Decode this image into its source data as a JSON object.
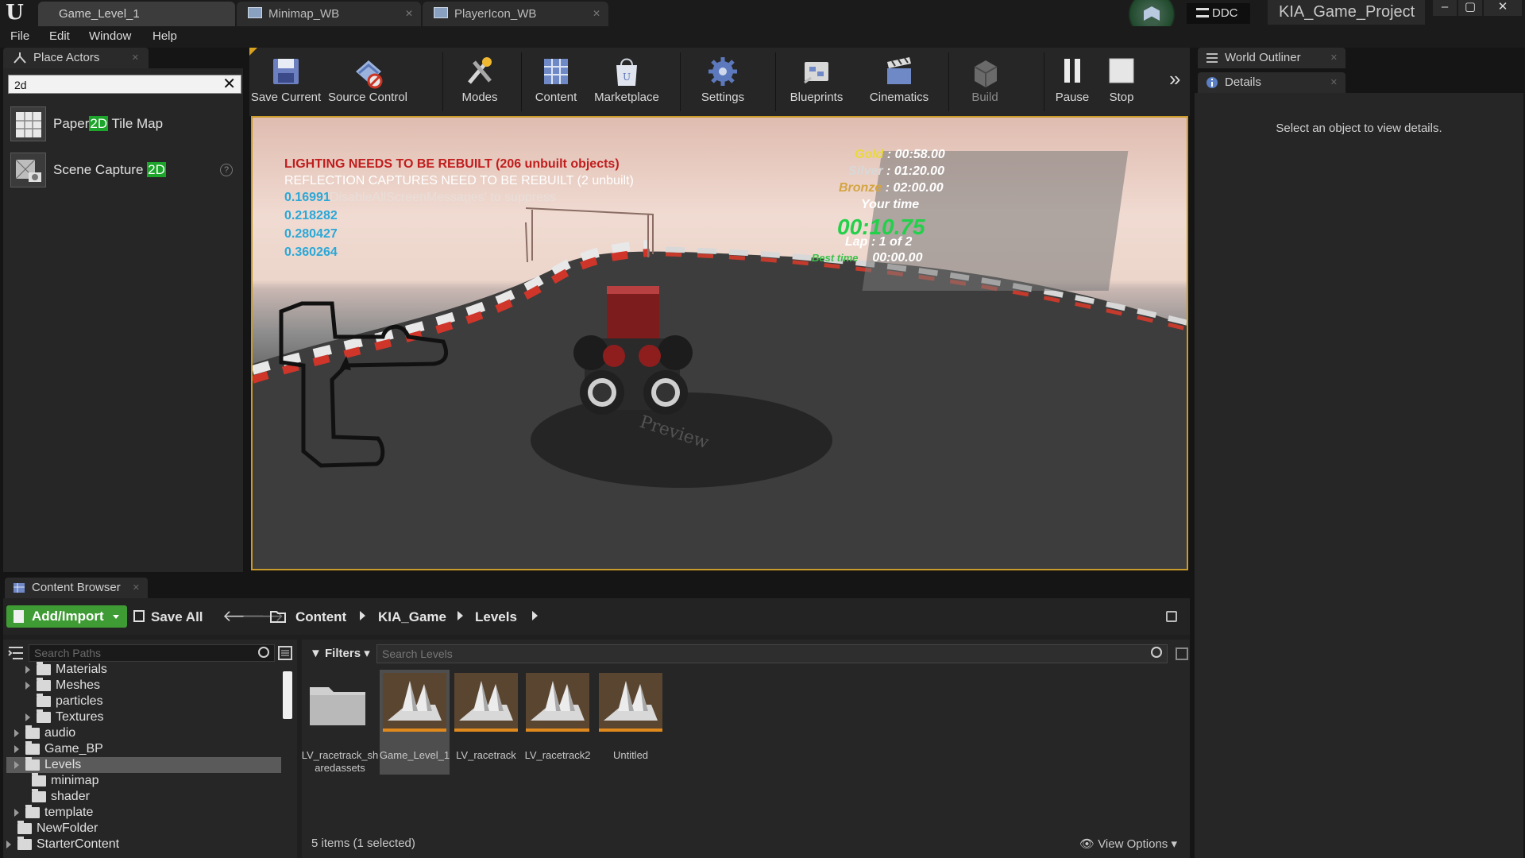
{
  "window": {
    "tabs": [
      {
        "label": "Game_Level_1"
      },
      {
        "label": "Minimap_WB"
      },
      {
        "label": "PlayerIcon_WB"
      }
    ],
    "ddc_label": "DDC",
    "project_name": "KIA_Game_Project",
    "window_controls": {
      "minimize": "–",
      "maximize": "▢",
      "close": "✕"
    }
  },
  "menu": [
    "File",
    "Edit",
    "Window",
    "Help"
  ],
  "place_actors": {
    "tab_label": "Place Actors",
    "search_value": "2d",
    "items": [
      {
        "pre": "Paper",
        "match": "2D",
        "post": " Tile Map"
      },
      {
        "pre": "Scene Capture ",
        "match": "2D",
        "post": ""
      }
    ]
  },
  "toolbar": {
    "buttons": [
      {
        "label": "Save Current",
        "icon": "save-icon"
      },
      {
        "label": "Source Control",
        "icon": "source-control-icon"
      },
      {
        "label": "Modes",
        "icon": "modes-icon"
      },
      {
        "label": "Content",
        "icon": "content-icon"
      },
      {
        "label": "Marketplace",
        "icon": "marketplace-icon"
      },
      {
        "label": "Settings",
        "icon": "settings-icon"
      },
      {
        "label": "Blueprints",
        "icon": "blueprints-icon"
      },
      {
        "label": "Cinematics",
        "icon": "cinematics-icon"
      },
      {
        "label": "Build",
        "icon": "build-icon"
      },
      {
        "label": "Pause",
        "icon": "pause-icon"
      },
      {
        "label": "Stop",
        "icon": "stop-icon"
      }
    ]
  },
  "viewport": {
    "messages": {
      "lighting": "LIGHTING NEEDS TO BE REBUILT (206 unbuilt objects)",
      "reflection": "REFLECTION CAPTURES NEED TO BE REBUILT (2 unbuilt)",
      "suppress": "'DisableAllScreenMessages' to suppress",
      "values": [
        "0.16991",
        "0.218282",
        "0.280427",
        "0.360264"
      ]
    },
    "hud": {
      "gold_label": "Gold",
      "gold_time": "00:58.00",
      "silver_label": "Silver",
      "silver_time": "01:20.00",
      "bronze_label": "Bronze",
      "bronze_time": "02:00.00",
      "your_time_label": "Your time",
      "current_time": "00:10.75",
      "lap_text": "Lap  :  1 of 2",
      "best_label": "Best time",
      "best_time": "00:00.00"
    },
    "watermark": "Preview",
    "colors": {
      "gold": "#e9d93a",
      "silver": "#d8d8d8",
      "bronze": "#d4a542",
      "current_time": "#22d04a",
      "best": "#3ec24a",
      "lighting": "#c01d1d"
    }
  },
  "right_panels": {
    "outliner_label": "World Outliner",
    "details_label": "Details",
    "details_message": "Select an object to view details."
  },
  "content_browser": {
    "tab_label": "Content Browser",
    "add_import": "Add/Import",
    "save_all": "Save All",
    "breadcrumbs": [
      "Content",
      "KIA_Game",
      "Levels"
    ],
    "path_search_placeholder": "Search Paths",
    "tree": [
      {
        "name": "Materials",
        "arrow": true
      },
      {
        "name": "Meshes",
        "arrow": true
      },
      {
        "name": "particles",
        "arrow": false
      },
      {
        "name": "Textures",
        "arrow": true
      },
      {
        "name": "audio",
        "arrow": true
      },
      {
        "name": "Game_BP",
        "arrow": true
      },
      {
        "name": "Levels",
        "arrow": true,
        "selected": true
      },
      {
        "name": "minimap",
        "arrow": false
      },
      {
        "name": "shader",
        "arrow": false
      },
      {
        "name": "template",
        "arrow": true
      },
      {
        "name": "NewFolder",
        "arrow": false
      },
      {
        "name": "StarterContent",
        "arrow": true
      }
    ],
    "filters_label": "Filters",
    "asset_search_placeholder": "Search Levels",
    "assets": [
      {
        "name": "LV_racetrack_sharedassets",
        "type": "folder"
      },
      {
        "name": "Game_Level_1",
        "type": "level",
        "selected": true
      },
      {
        "name": "LV_racetrack",
        "type": "level"
      },
      {
        "name": "LV_racetrack2",
        "type": "level"
      },
      {
        "name": "Untitled",
        "type": "level"
      }
    ],
    "items_count": "5 items (1 selected)",
    "view_options": "View Options"
  }
}
